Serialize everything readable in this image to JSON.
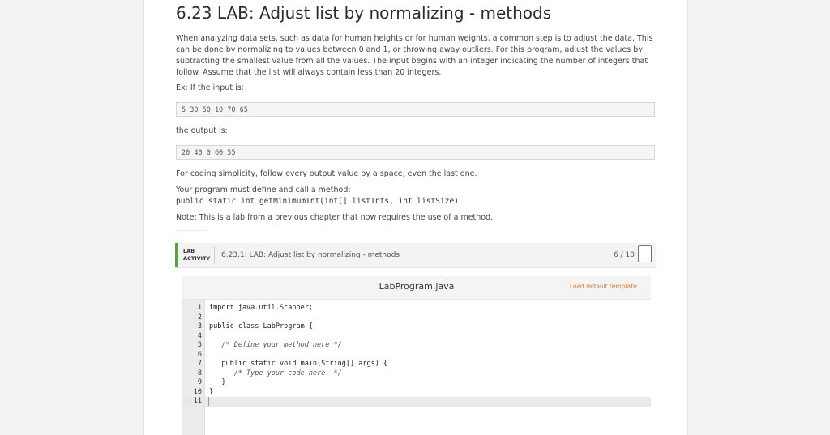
{
  "title": "6.23 LAB: Adjust list by normalizing - methods",
  "description": "When analyzing data sets, such as data for human heights or for human weights, a common step is to adjust the data. This can be done by normalizing to values between 0 and 1, or throwing away outliers. For this program, adjust the values by subtracting the smallest value from all the values. The input begins with an integer indicating the number of integers that follow. Assume that the list will always contain less than 20 integers.",
  "example_intro": "Ex: If the input is:",
  "example_input": "5 30 50 10 70 65",
  "output_intro": "the output is:",
  "example_output": "20 40 0 60 55",
  "simplicity_note": "For coding simplicity, follow every output value by a space, even the last one.",
  "method_intro": "Your program must define and call a method:",
  "method_signature": "public static int getMinimumInt(int[] listInts, int listSize)",
  "note": "Note: This is a lab from a previous chapter that now requires the use of a method.",
  "lab": {
    "tag": "LAB ACTIVITY",
    "name": "6.23.1: LAB: Adjust list by normalizing - methods",
    "score": "6 / 10"
  },
  "editor": {
    "filename": "LabProgram.java",
    "load_template": "Load default template...",
    "lines": [
      {
        "n": "1",
        "text": "import java.util.Scanner;"
      },
      {
        "n": "2",
        "text": ""
      },
      {
        "n": "3",
        "text": "public class LabProgram {"
      },
      {
        "n": "4",
        "text": ""
      },
      {
        "n": "5",
        "text": "   /* Define your method here */"
      },
      {
        "n": "6",
        "text": ""
      },
      {
        "n": "7",
        "text": "   public static void main(String[] args) {"
      },
      {
        "n": "8",
        "text": "      /* Type your code here. */"
      },
      {
        "n": "9",
        "text": "   }"
      },
      {
        "n": "10",
        "text": "}"
      },
      {
        "n": "11",
        "text": ""
      }
    ]
  }
}
